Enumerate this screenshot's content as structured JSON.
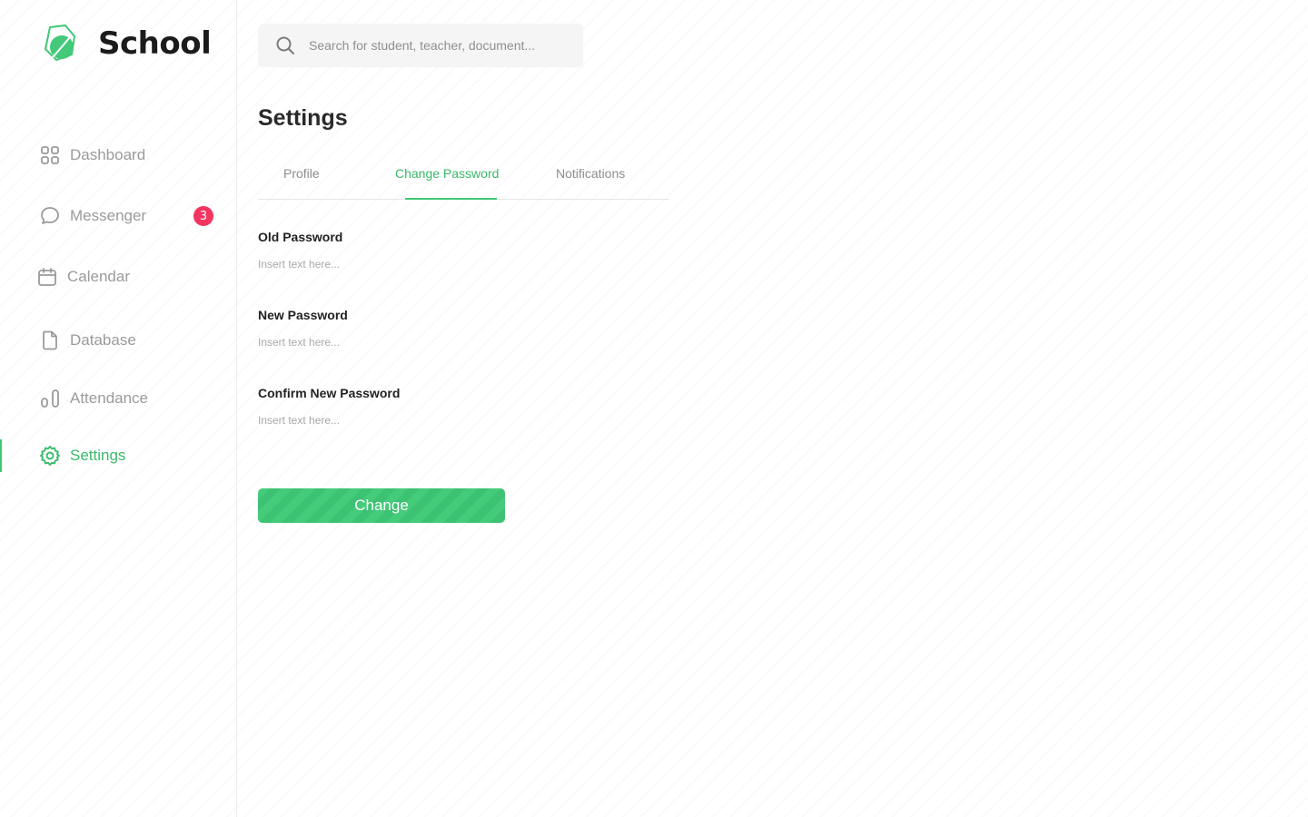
{
  "brand": {
    "name": "School"
  },
  "nav": [
    {
      "id": "dashboard",
      "label": "Dashboard",
      "icon": "grid-icon"
    },
    {
      "id": "messenger",
      "label": "Messenger",
      "icon": "chat-bubble-icon",
      "badge": "3"
    },
    {
      "id": "calendar",
      "label": "Calendar",
      "icon": "calendar-icon"
    },
    {
      "id": "database",
      "label": "Database",
      "icon": "document-icon"
    },
    {
      "id": "attendance",
      "label": "Attendance",
      "icon": "bar-chart-icon"
    },
    {
      "id": "settings",
      "label": "Settings",
      "icon": "gear-icon",
      "active": true
    }
  ],
  "search": {
    "placeholder": "Search for student, teacher, document..."
  },
  "page": {
    "title": "Settings"
  },
  "tabs": [
    {
      "label": "Profile"
    },
    {
      "label": "Change Password",
      "active": true
    },
    {
      "label": "Notifications"
    }
  ],
  "form": {
    "fields": [
      {
        "label": "Old Password",
        "placeholder": "Insert text here..."
      },
      {
        "label": "New Password",
        "placeholder": "Insert text here..."
      },
      {
        "label": "Confirm New Password",
        "placeholder": "Insert text here..."
      }
    ],
    "submit_label": "Change"
  },
  "colors": {
    "accent": "#3fc874",
    "badge": "#f3355f",
    "muted": "#9b9b9b"
  }
}
